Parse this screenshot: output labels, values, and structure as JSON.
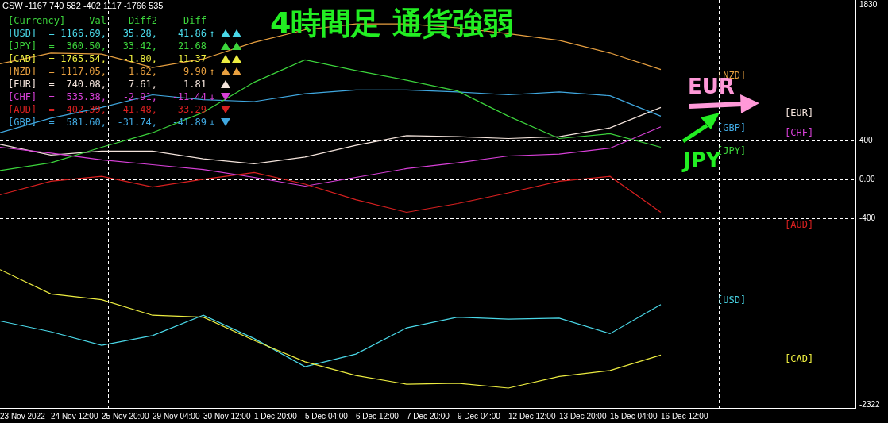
{
  "indicator_label": "CSW -1167 740 582 -402 1117 -1766 535",
  "headline": "4時間足 通貨強弱",
  "table": {
    "columns": [
      "[Currency]",
      "Val",
      "Diff2",
      "Diff"
    ],
    "rows": [
      {
        "currency": "[USD]",
        "eq": "=",
        "val": "1166.69,",
        "diff2": "35.28,",
        "diff": "41.86",
        "arrow": "↑",
        "color": "#4ad8e8",
        "signals": [
          {
            "kind": "up"
          },
          {
            "kind": "up"
          }
        ]
      },
      {
        "currency": "[JPY]",
        "eq": "=",
        "val": "360.50,",
        "diff2": "33.42,",
        "diff": "21.68",
        "color": "#3cd43c",
        "signals": [
          {
            "kind": "up"
          },
          {
            "kind": "up"
          }
        ]
      },
      {
        "currency": "[CAD]",
        "eq": "=",
        "val": "1765.54,",
        "diff2": "-1.80,",
        "diff": "11.37",
        "color": "#ecec40",
        "signals": [
          {
            "kind": "up"
          },
          {
            "kind": "up"
          }
        ]
      },
      {
        "currency": "[NZD]",
        "eq": "=",
        "val": "1117.05,",
        "diff2": "1.62,",
        "diff": "9.90",
        "arrow": "↑",
        "color": "#e8a040",
        "signals": [
          {
            "kind": "up"
          },
          {
            "kind": "up"
          }
        ]
      },
      {
        "currency": "[EUR]",
        "eq": "=",
        "val": "740.08,",
        "diff2": "7.61,",
        "diff": "1.81",
        "color": "#f4e4dc",
        "signals": [
          {
            "kind": "up"
          }
        ]
      },
      {
        "currency": "[CHF]",
        "eq": "=",
        "val": "535.38,",
        "diff2": "-2.91,",
        "diff": "-11.44",
        "arrow": "↓",
        "color": "#d840d8",
        "signals": [
          {
            "kind": "down"
          }
        ]
      },
      {
        "currency": "[AUD]",
        "eq": "=",
        "val": "-402.39,",
        "diff2": "-41.48,",
        "diff": "-33.29",
        "color": "#d82020",
        "signals": [
          {
            "kind": "down"
          }
        ]
      },
      {
        "currency": "[GBP]",
        "eq": "=",
        "val": "581.60,",
        "diff2": "-31.74,",
        "diff": "-41.89",
        "arrow": "↓",
        "color": "#40a8e0",
        "signals": [
          {
            "kind": "down"
          }
        ]
      }
    ]
  },
  "chart_data": {
    "type": "line",
    "categories": [
      "23 Nov 2022",
      "24 Nov 12:00",
      "25 Nov 20:00",
      "29 Nov 04:00",
      "30 Nov 12:00",
      "1 Dec 20:00",
      "5 Dec 04:00",
      "6 Dec 12:00",
      "7 Dec 20:00",
      "9 Dec 04:00",
      "12 Dec 12:00",
      "13 Dec 20:00",
      "15 Dec 04:00",
      "16 Dec 12:00"
    ],
    "ylim": [
      -2322,
      1830
    ],
    "grid": true,
    "yticks": [
      1830,
      400,
      {
        "value": 0,
        "label": "0.00"
      },
      -400,
      -2322
    ],
    "series": [
      {
        "name": "[NZD]",
        "color": "#e8a040",
        "values": [
          1190,
          1300,
          1290,
          1150,
          1240,
          1410,
          1540,
          1600,
          1600,
          1560,
          1500,
          1430,
          1300,
          1130
        ]
      },
      {
        "name": "[EUR]",
        "color": "#f4e4dc",
        "values": [
          360,
          250,
          290,
          290,
          210,
          160,
          230,
          350,
          450,
          440,
          420,
          440,
          530,
          740
        ]
      },
      {
        "name": "[GBP]",
        "color": "#40a8e0",
        "values": [
          480,
          630,
          740,
          870,
          820,
          800,
          880,
          920,
          920,
          900,
          870,
          900,
          860,
          650
        ]
      },
      {
        "name": "[CHF]",
        "color": "#d840d8",
        "values": [
          330,
          270,
          200,
          150,
          100,
          20,
          -70,
          20,
          110,
          170,
          240,
          260,
          320,
          540
        ]
      },
      {
        "name": "[JPY]",
        "color": "#3cd43c",
        "values": [
          90,
          170,
          330,
          480,
          690,
          1000,
          1230,
          1120,
          1020,
          910,
          650,
          420,
          470,
          330
        ]
      },
      {
        "name": "[AUD]",
        "color": "#d82020",
        "values": [
          -160,
          -20,
          30,
          -80,
          0,
          70,
          -50,
          -210,
          -340,
          -250,
          -140,
          -20,
          30,
          -340
        ]
      },
      {
        "name": "[USD]",
        "color": "#4ad8e8",
        "values": [
          -1460,
          -1570,
          -1710,
          -1610,
          -1400,
          -1640,
          -1930,
          -1800,
          -1530,
          -1420,
          -1440,
          -1430,
          -1590,
          -1290
        ]
      },
      {
        "name": "[CAD]",
        "color": "#ecec40",
        "values": [
          -930,
          -1180,
          -1240,
          -1400,
          -1420,
          -1660,
          -1880,
          -2020,
          -2110,
          -2100,
          -2150,
          -2030,
          -1970,
          -1810
        ]
      }
    ]
  },
  "annotations": [
    {
      "text": "EUR",
      "color": "#ff99d8"
    },
    {
      "text": "JPY",
      "color": "#22ee22"
    }
  ]
}
